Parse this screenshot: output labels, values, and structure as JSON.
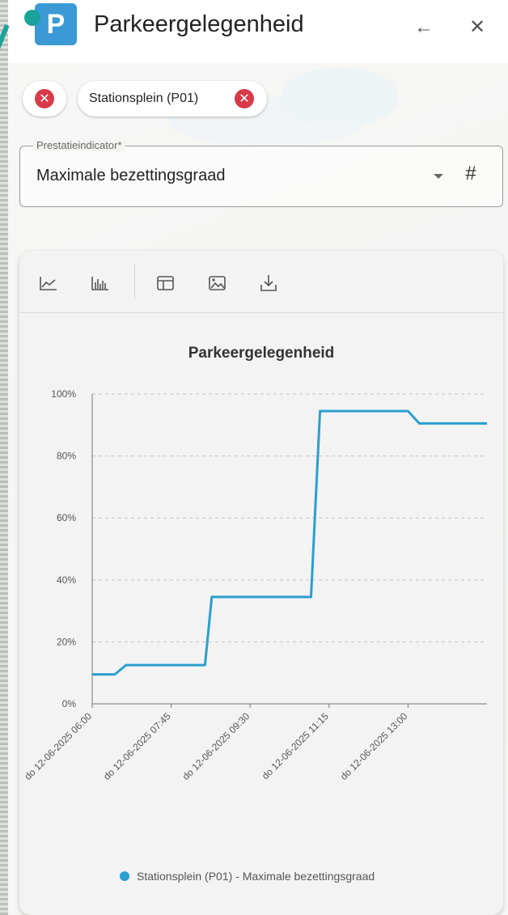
{
  "header": {
    "app_icon_letter": "P",
    "title": "Parkeergelegenheid",
    "back_icon": "arrow-left-icon",
    "close_icon": "close-icon"
  },
  "filters": {
    "chips": [
      {
        "label": "",
        "removable": true
      },
      {
        "label": "Stationsplein (P01)",
        "removable": true
      }
    ]
  },
  "indicator": {
    "legend": "Prestatieindicator*",
    "value": "Maximale bezettingsgraad",
    "hash_symbol": "#"
  },
  "toolbar": {
    "items": [
      {
        "icon": "line-chart-icon"
      },
      {
        "icon": "bar-chart-icon"
      },
      {
        "icon": "table-icon"
      },
      {
        "icon": "image-icon"
      },
      {
        "icon": "download-icon"
      }
    ]
  },
  "colors": {
    "accent": "#3b9ad6",
    "series": "#2a9fd0",
    "pin": "#1aa39a",
    "chip_remove": "#d93a4a"
  },
  "chart_data": {
    "type": "line",
    "title": "Parkeergelegenheid",
    "xlabel": "",
    "ylabel": "",
    "ylim": [
      0,
      100
    ],
    "yticks": [
      "0%",
      "20%",
      "40%",
      "60%",
      "80%",
      "100%"
    ],
    "xticks": [
      "do 12-06-2025 06:00",
      "do 12-06-2025 07:45",
      "do 12-06-2025 09:30",
      "do 12-06-2025 11:15",
      "do 12-06-2025 13:00"
    ],
    "grid": true,
    "legend_position": "bottom",
    "series": [
      {
        "name": "Stationsplein (P01) - Maximale bezettingsgraad",
        "x_hours": [
          6.0,
          6.5,
          6.75,
          8.5,
          8.65,
          10.85,
          11.05,
          13.0,
          13.25,
          14.75
        ],
        "values": [
          9.5,
          9.5,
          12.5,
          12.5,
          34.5,
          34.5,
          94.5,
          94.5,
          90.5,
          90.5
        ]
      }
    ]
  }
}
